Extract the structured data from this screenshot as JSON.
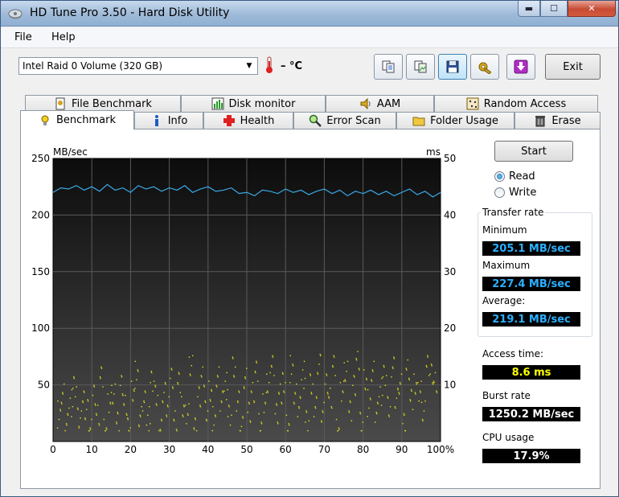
{
  "window": {
    "title": "HD Tune Pro 3.50 - Hard Disk Utility"
  },
  "menu": {
    "file": "File",
    "help": "Help"
  },
  "toolbar": {
    "drive": "Intel   Raid 0 Volume (320 GB)",
    "temperature": "– °C",
    "exit_label": "Exit"
  },
  "tabs_row1": [
    {
      "label": "File Benchmark",
      "icon": "file-benchmark-icon"
    },
    {
      "label": "Disk monitor",
      "icon": "disk-monitor-icon"
    },
    {
      "label": "AAM",
      "icon": "speaker-icon"
    },
    {
      "label": "Random Access",
      "icon": "random-access-icon"
    }
  ],
  "tabs_row2": [
    {
      "label": "Benchmark",
      "icon": "benchmark-icon"
    },
    {
      "label": "Info",
      "icon": "info-icon"
    },
    {
      "label": "Health",
      "icon": "health-cross-icon"
    },
    {
      "label": "Error Scan",
      "icon": "magnifier-icon"
    },
    {
      "label": "Folder Usage",
      "icon": "folder-icon"
    },
    {
      "label": "Erase",
      "icon": "trash-icon"
    }
  ],
  "controls": {
    "start_label": "Start",
    "read_label": "Read",
    "write_label": "Write",
    "selected_mode": "Read"
  },
  "stats": {
    "transfer_rate_title": "Transfer rate",
    "minimum_label": "Minimum",
    "minimum_value": "205.1 MB/sec",
    "maximum_label": "Maximum",
    "maximum_value": "227.4 MB/sec",
    "average_label": "Average:",
    "average_value": "219.1 MB/sec",
    "access_time_label": "Access time:",
    "access_time_value": "8.6 ms",
    "burst_rate_label": "Burst rate",
    "burst_rate_value": "1250.2 MB/sec",
    "cpu_usage_label": "CPU usage",
    "cpu_usage_value": "17.9%"
  },
  "colors": {
    "transfer_line": "#3aa9e6",
    "access_points": "#e6e61e",
    "chart_bg": "#111111",
    "value_blue": "#2ab0ff",
    "value_yellow": "#ffff00"
  },
  "chart_data": {
    "type": "line",
    "ylabel_left": "MB/sec",
    "ylabel_right": "ms",
    "ylim_left": [
      0,
      250
    ],
    "ylim_right": [
      0,
      50
    ],
    "y_ticks_left": [
      "250",
      "200",
      "150",
      "100",
      "50"
    ],
    "y_ticks_right": [
      "50",
      "40",
      "30",
      "20",
      "10"
    ],
    "x_ticks": [
      "0",
      "10",
      "20",
      "30",
      "40",
      "50",
      "60",
      "70",
      "80",
      "90",
      "100%"
    ],
    "grid": true,
    "series": [
      {
        "axis": "left",
        "x": [
          0,
          2,
          4,
          6,
          8,
          10,
          12,
          14,
          16,
          18,
          20,
          22,
          24,
          26,
          28,
          30,
          32,
          34,
          36,
          38,
          40,
          42,
          44,
          46,
          48,
          50,
          52,
          54,
          56,
          58,
          60,
          62,
          64,
          66,
          68,
          70,
          72,
          74,
          76,
          78,
          80,
          82,
          84,
          86,
          88,
          90,
          92,
          94,
          96,
          98,
          100
        ],
        "values": [
          220,
          224,
          223,
          226,
          222,
          225,
          221,
          227,
          222,
          224,
          220,
          226,
          223,
          225,
          221,
          224,
          222,
          226,
          220,
          223,
          225,
          221,
          222,
          224,
          219,
          220,
          217,
          222,
          221,
          219,
          223,
          220,
          222,
          218,
          221,
          223,
          219,
          222,
          217,
          221,
          219,
          222,
          218,
          221,
          217,
          220,
          223,
          218,
          221,
          216,
          220
        ]
      }
    ],
    "access_scatter": {
      "axis": "right",
      "description_range_ms": [
        2,
        15
      ],
      "x": [
        1,
        2,
        3,
        4,
        5,
        6,
        7,
        8,
        9,
        10,
        11,
        12,
        13,
        14,
        15,
        16,
        17,
        18,
        19,
        20,
        21,
        22,
        23,
        24,
        25,
        26,
        27,
        28,
        29,
        30,
        31,
        32,
        33,
        34,
        35,
        36,
        37,
        38,
        39,
        40,
        41,
        42,
        43,
        44,
        45,
        46,
        47,
        48,
        49,
        50,
        51,
        52,
        53,
        54,
        55,
        56,
        57,
        58,
        59,
        60,
        61,
        62,
        63,
        64,
        65,
        66,
        67,
        68,
        69,
        70,
        71,
        72,
        73,
        74,
        75,
        76,
        77,
        78,
        79,
        80,
        81,
        82,
        83,
        84,
        85,
        86,
        87,
        88,
        89,
        90,
        91,
        92,
        93,
        94,
        95,
        96,
        97,
        98
      ],
      "values": [
        5,
        9,
        3,
        7,
        10,
        4,
        8,
        6,
        2,
        9,
        5,
        11,
        3,
        7,
        8,
        4,
        10,
        6,
        3,
        9,
        12,
        5,
        7,
        4,
        11,
        8,
        3,
        9,
        6,
        12,
        4,
        10,
        7,
        5,
        13,
        3,
        8,
        11,
        6,
        9,
        4,
        12,
        7,
        10,
        5,
        13,
        8,
        3,
        11,
        6,
        9,
        12,
        4,
        7,
        10,
        14,
        5,
        8,
        11,
        3,
        13,
        9,
        6,
        12,
        4,
        10,
        7,
        14,
        5,
        11,
        8,
        13,
        3,
        9,
        12,
        6,
        10,
        14,
        4,
        11,
        7,
        13,
        5,
        9,
        12,
        6,
        14,
        8,
        10,
        4,
        13,
        7,
        11,
        9,
        5,
        14,
        12,
        10
      ]
    }
  }
}
